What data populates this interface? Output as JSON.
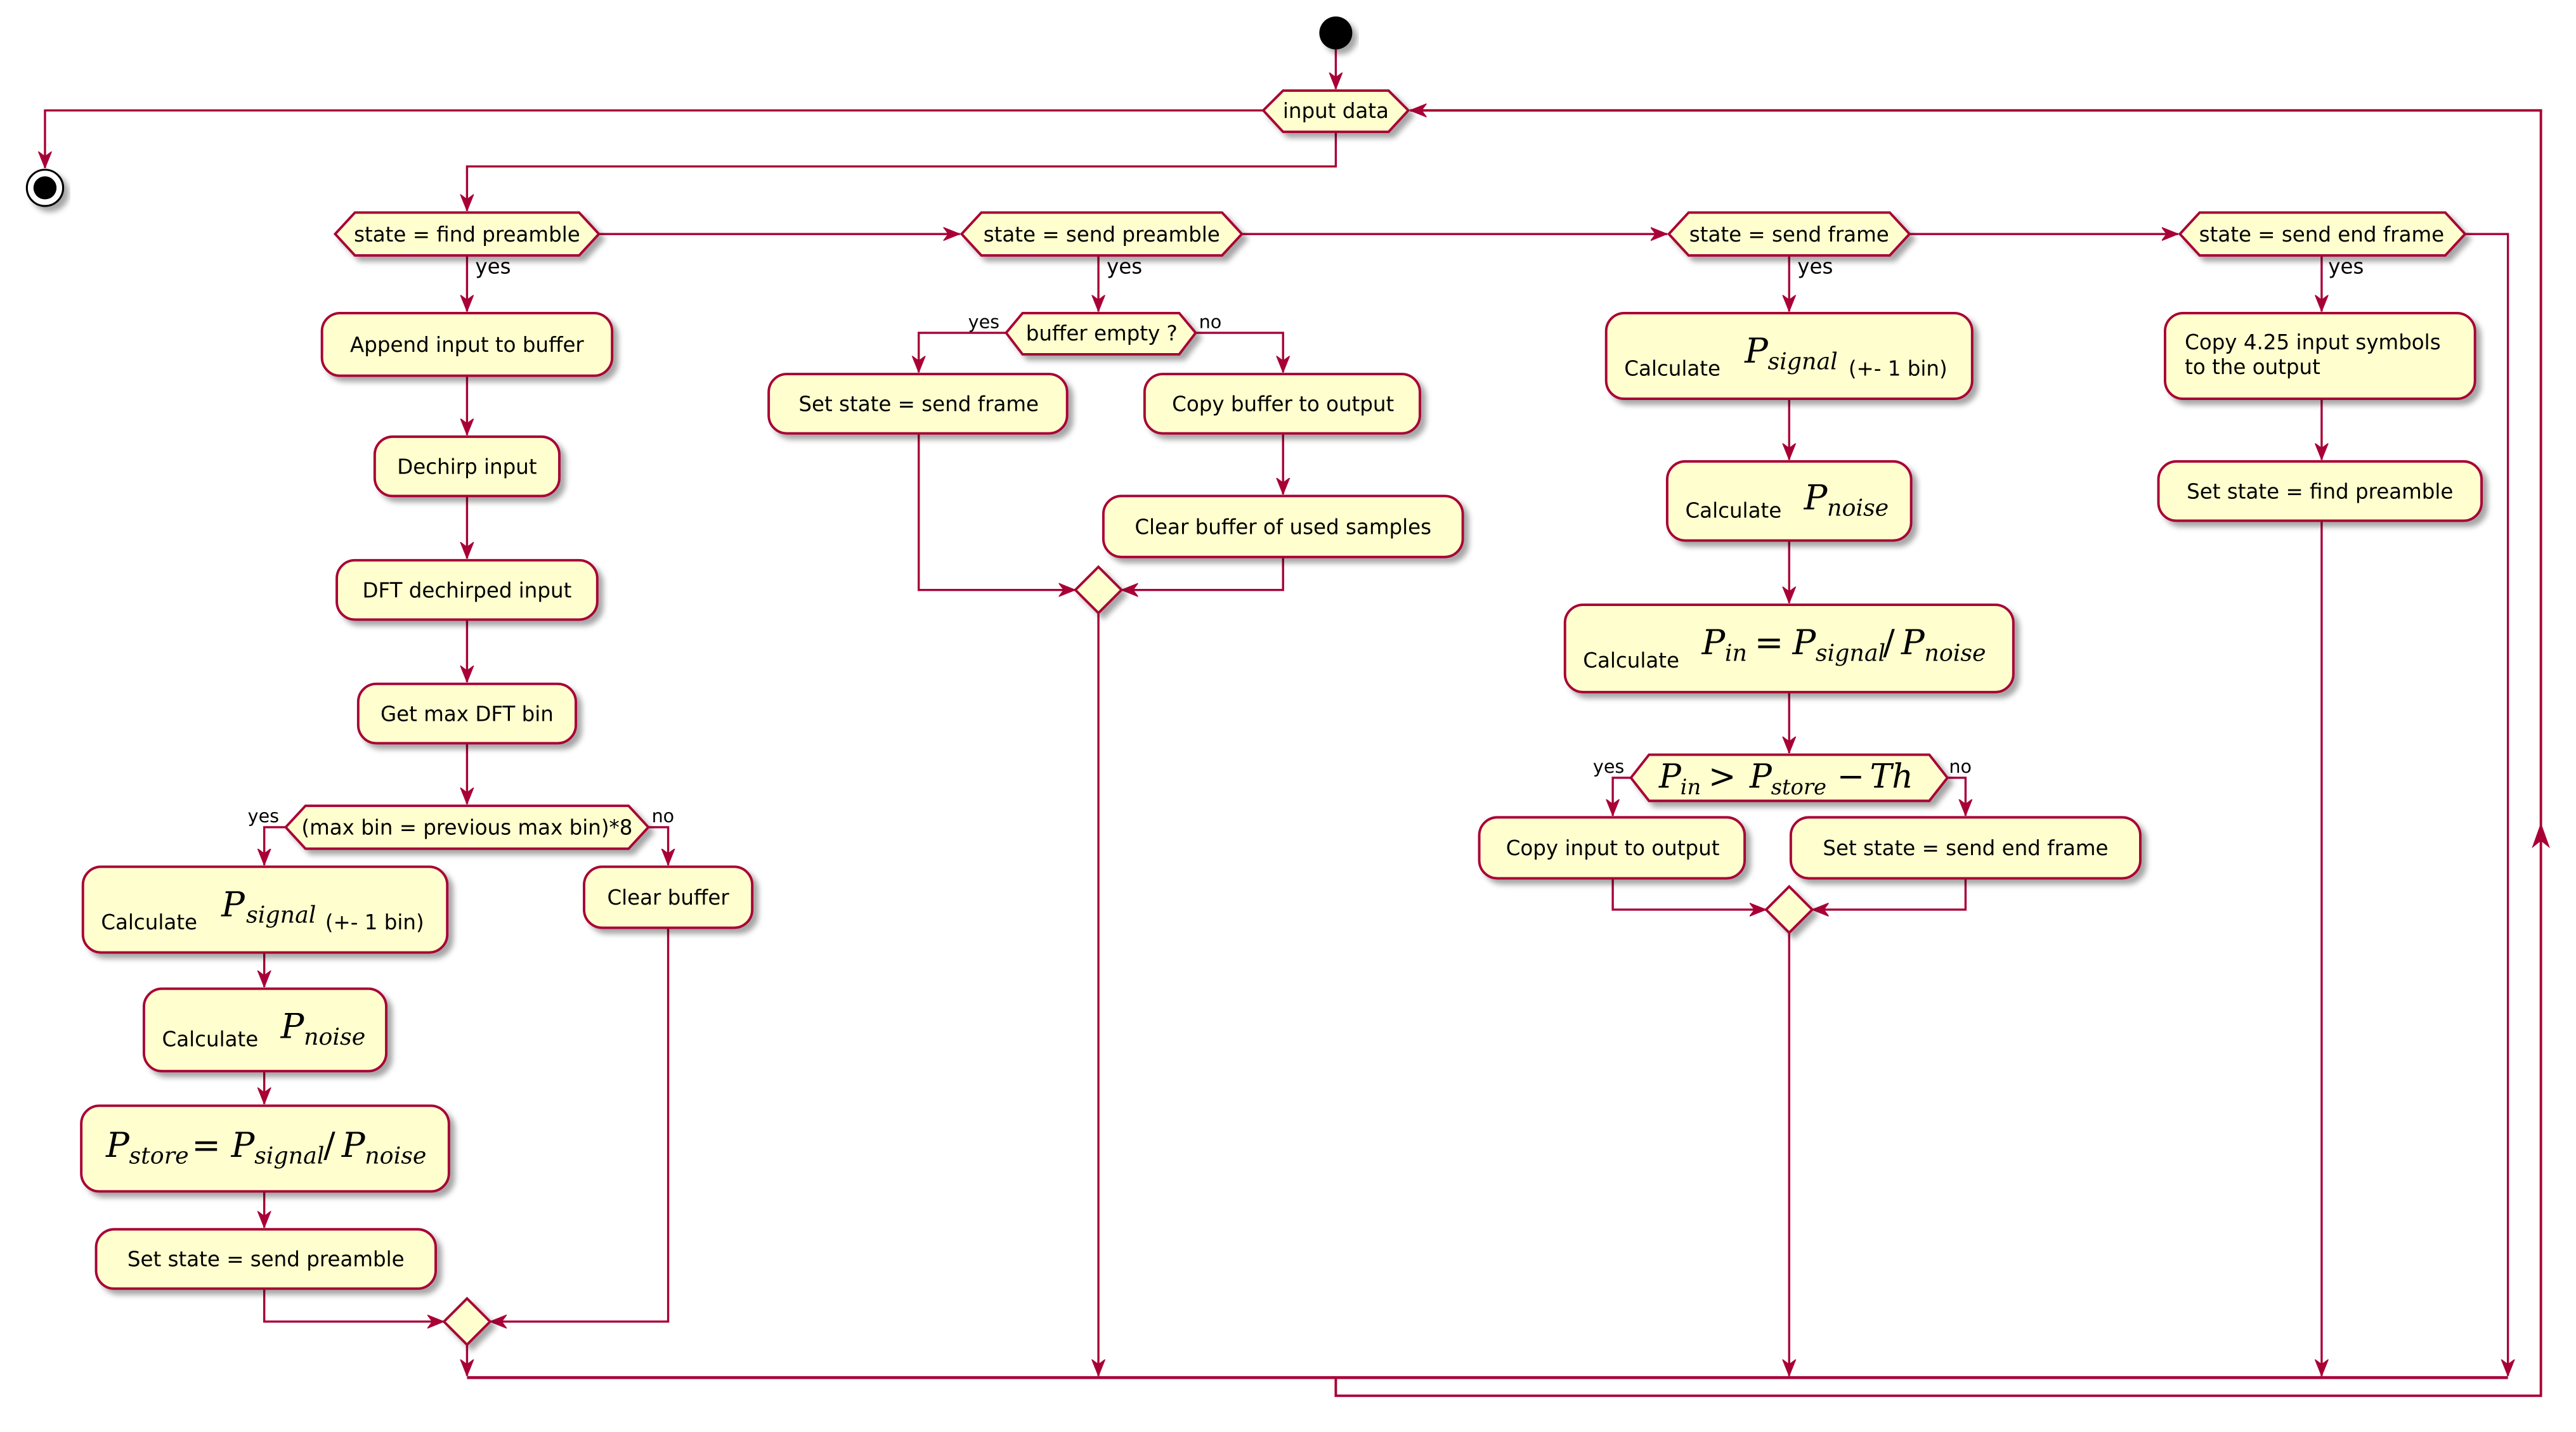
{
  "diagram": {
    "type": "activity-diagram",
    "colors": {
      "line": "#a80036",
      "node_fill": "#fefece",
      "text": "#000000",
      "start_fill": "#000000"
    },
    "start_node": "start",
    "end_node": "stop",
    "input_decision": "input data",
    "branches": [
      {
        "condition": "state = find preamble",
        "yes_label": "yes",
        "steps": [
          "Append input to buffer",
          "Dechirp input",
          "DFT dechirped input",
          "Get max DFT bin"
        ],
        "decision": {
          "condition": "(max bin = previous max bin)*8",
          "yes_label": "yes",
          "no_label": "no",
          "yes_steps": [
            {
              "prefix": "Calculate",
              "math": "P",
              "sub": "signal",
              "suffix": "(+- 1 bin)"
            },
            {
              "prefix": "Calculate",
              "math": "P",
              "sub": "noise",
              "suffix": ""
            },
            {
              "prefix": "",
              "math": "P_store = P_signal / P_noise",
              "sub": "",
              "suffix": ""
            },
            {
              "prefix": "Set state = send preamble",
              "math": "",
              "sub": "",
              "suffix": ""
            }
          ],
          "no_steps": [
            "Clear buffer"
          ]
        }
      },
      {
        "condition": "state = send preamble",
        "yes_label": "yes",
        "decision": {
          "condition": "buffer empty ?",
          "yes_label": "yes",
          "no_label": "no",
          "yes_steps": [
            "Set state = send frame"
          ],
          "no_steps": [
            "Copy buffer to output",
            "Clear buffer of used samples"
          ]
        }
      },
      {
        "condition": "state = send frame",
        "yes_label": "yes",
        "steps": [
          {
            "prefix": "Calculate",
            "math": "P_signal",
            "suffix": "(+- 1 bin)"
          },
          {
            "prefix": "Calculate",
            "math": "P_noise",
            "suffix": ""
          },
          {
            "prefix": "Calculate",
            "math": "P_in = P_signal / P_noise",
            "suffix": ""
          }
        ],
        "decision": {
          "condition": "P_in > P_store - Th",
          "yes_label": "yes",
          "no_label": "no",
          "yes_steps": [
            "Copy input to output"
          ],
          "no_steps": [
            "Set state = send end frame"
          ]
        }
      },
      {
        "condition": "state = send end frame",
        "yes_label": "yes",
        "steps": [
          "Copy 4.25 input symbols\nto the output",
          "Set state = find preamble"
        ]
      }
    ]
  },
  "labels": {
    "input_data": "input data",
    "yes": "yes",
    "no": "no",
    "calculate": "Calculate",
    "pm1bin": "(+- 1 bin)",
    "P": "P",
    "Th": "Th",
    "sub_signal": "signal",
    "sub_noise": "noise",
    "sub_store": "store",
    "sub_in": "in",
    "eq": "=",
    "slash": "/",
    "gt": ">",
    "minus": "−",
    "c1": {
      "cond": "state = find preamble",
      "append": "Append input to buffer",
      "dechirp": "Dechirp input",
      "dft": "DFT dechirped input",
      "getmax": "Get max DFT bin",
      "maxbin_cond": "(max bin = previous max bin)*8",
      "set_send_preamble": "Set state = send preamble",
      "clear_buffer": "Clear buffer"
    },
    "c2": {
      "cond": "state = send preamble",
      "buffer_empty": "buffer empty ?",
      "set_send_frame": "Set state = send frame",
      "copy_buffer": "Copy buffer to output",
      "clear_used": "Clear buffer of used samples"
    },
    "c3": {
      "cond": "state = send frame",
      "copy_input": "Copy input to output",
      "set_end_frame": "Set state = send end frame"
    },
    "c4": {
      "cond": "state = send end frame",
      "copy425_line1": "Copy 4.25 input symbols",
      "copy425_line2": "to the output",
      "set_find_preamble": "Set state = find preamble"
    }
  }
}
